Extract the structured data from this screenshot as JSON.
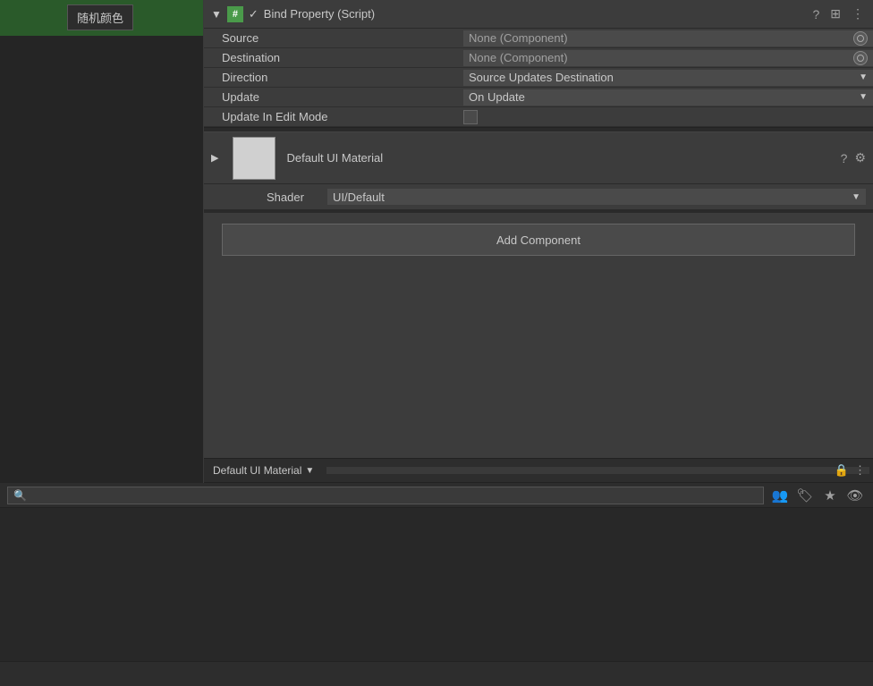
{
  "app": {
    "title": "Unity Inspector"
  },
  "left_panel": {
    "chinese_button": "随机颜色"
  },
  "component": {
    "hash_symbol": "#",
    "checked": "✓",
    "title": "Bind Property (Script)",
    "collapse_arrow": "▼",
    "help_icon": "?",
    "slider_icon": "⊞",
    "more_icon": "⋮"
  },
  "properties": {
    "source": {
      "label": "Source",
      "value": "None (Component)"
    },
    "destination": {
      "label": "Destination",
      "value": "None (Component)"
    },
    "direction": {
      "label": "Direction",
      "value": "Source Updates Destination"
    },
    "update": {
      "label": "Update",
      "value": "On Update"
    },
    "update_edit_mode": {
      "label": "Update In Edit Mode"
    }
  },
  "material": {
    "name": "Default UI Material",
    "shader_label": "Shader",
    "shader_value": "UI/Default",
    "expand_arrow": "▶"
  },
  "add_component": {
    "label": "Add Component"
  },
  "bottom_tab": {
    "name": "Default UI Material",
    "arrow": "▼"
  },
  "project_toolbar": {
    "search_placeholder": "",
    "lock_icon": "🔒",
    "dots_icon": "⋮",
    "filter_icons": [
      "👥",
      "🏷",
      "★",
      "👁"
    ]
  }
}
